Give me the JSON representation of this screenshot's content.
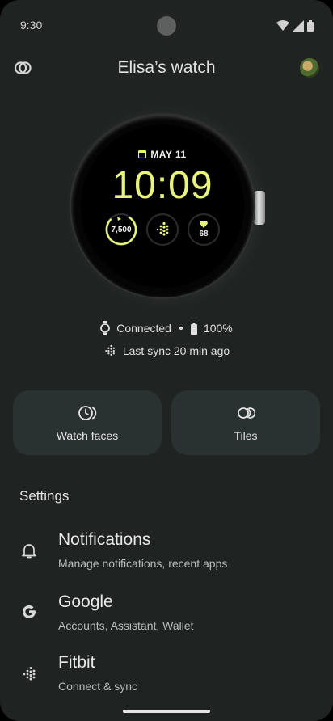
{
  "status_bar": {
    "time": "9:30"
  },
  "header": {
    "title": "Elisa’s watch"
  },
  "watch_face": {
    "date": "MAY 11",
    "time": "10:09",
    "steps": "7,500",
    "heart_rate": "68",
    "accent_color": "#e8f57a"
  },
  "connection": {
    "status": "Connected",
    "battery": "100%",
    "last_sync": "Last sync 20 min ago"
  },
  "cards": {
    "watch_faces_label": "Watch faces",
    "tiles_label": "Tiles"
  },
  "settings": {
    "title": "Settings",
    "items": [
      {
        "title": "Notifications",
        "subtitle": "Manage notifications, recent apps",
        "icon": "bell-icon"
      },
      {
        "title": "Google",
        "subtitle": "Accounts, Assistant, Wallet",
        "icon": "google-icon"
      },
      {
        "title": "Fitbit",
        "subtitle": "Connect & sync",
        "icon": "fitbit-icon"
      }
    ]
  },
  "colors": {
    "background": "#1f2322",
    "card": "#2a3231"
  }
}
